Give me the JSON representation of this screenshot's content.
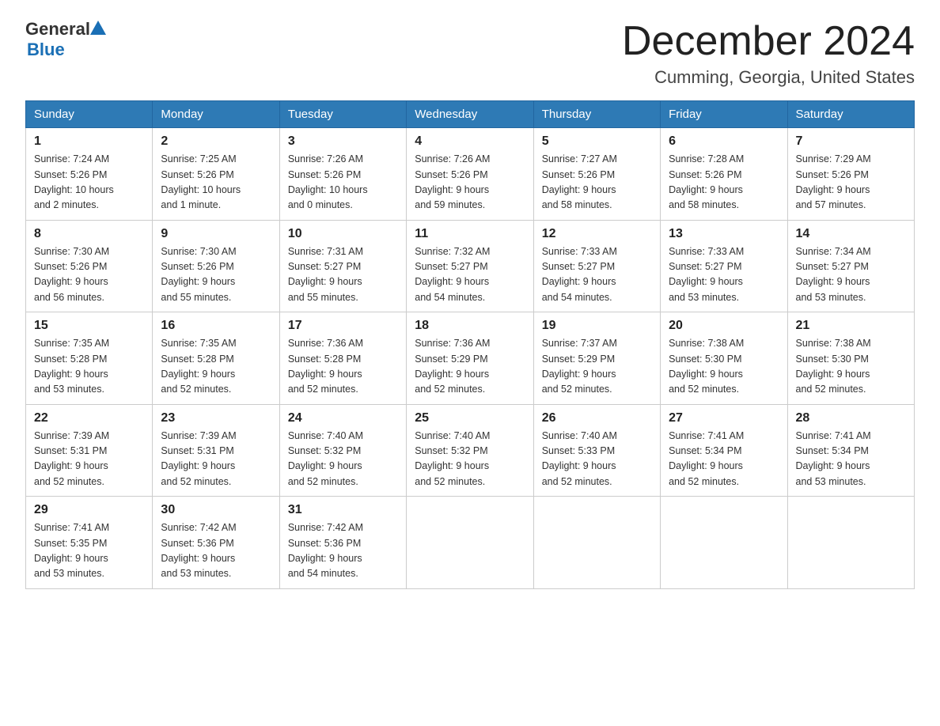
{
  "header": {
    "logo_general": "General",
    "logo_blue": "Blue",
    "title": "December 2024",
    "subtitle": "Cumming, Georgia, United States"
  },
  "days_of_week": [
    "Sunday",
    "Monday",
    "Tuesday",
    "Wednesday",
    "Thursday",
    "Friday",
    "Saturday"
  ],
  "weeks": [
    [
      {
        "day": "1",
        "sunrise": "7:24 AM",
        "sunset": "5:26 PM",
        "daylight": "10 hours and 2 minutes."
      },
      {
        "day": "2",
        "sunrise": "7:25 AM",
        "sunset": "5:26 PM",
        "daylight": "10 hours and 1 minute."
      },
      {
        "day": "3",
        "sunrise": "7:26 AM",
        "sunset": "5:26 PM",
        "daylight": "10 hours and 0 minutes."
      },
      {
        "day": "4",
        "sunrise": "7:26 AM",
        "sunset": "5:26 PM",
        "daylight": "9 hours and 59 minutes."
      },
      {
        "day": "5",
        "sunrise": "7:27 AM",
        "sunset": "5:26 PM",
        "daylight": "9 hours and 58 minutes."
      },
      {
        "day": "6",
        "sunrise": "7:28 AM",
        "sunset": "5:26 PM",
        "daylight": "9 hours and 58 minutes."
      },
      {
        "day": "7",
        "sunrise": "7:29 AM",
        "sunset": "5:26 PM",
        "daylight": "9 hours and 57 minutes."
      }
    ],
    [
      {
        "day": "8",
        "sunrise": "7:30 AM",
        "sunset": "5:26 PM",
        "daylight": "9 hours and 56 minutes."
      },
      {
        "day": "9",
        "sunrise": "7:30 AM",
        "sunset": "5:26 PM",
        "daylight": "9 hours and 55 minutes."
      },
      {
        "day": "10",
        "sunrise": "7:31 AM",
        "sunset": "5:27 PM",
        "daylight": "9 hours and 55 minutes."
      },
      {
        "day": "11",
        "sunrise": "7:32 AM",
        "sunset": "5:27 PM",
        "daylight": "9 hours and 54 minutes."
      },
      {
        "day": "12",
        "sunrise": "7:33 AM",
        "sunset": "5:27 PM",
        "daylight": "9 hours and 54 minutes."
      },
      {
        "day": "13",
        "sunrise": "7:33 AM",
        "sunset": "5:27 PM",
        "daylight": "9 hours and 53 minutes."
      },
      {
        "day": "14",
        "sunrise": "7:34 AM",
        "sunset": "5:27 PM",
        "daylight": "9 hours and 53 minutes."
      }
    ],
    [
      {
        "day": "15",
        "sunrise": "7:35 AM",
        "sunset": "5:28 PM",
        "daylight": "9 hours and 53 minutes."
      },
      {
        "day": "16",
        "sunrise": "7:35 AM",
        "sunset": "5:28 PM",
        "daylight": "9 hours and 52 minutes."
      },
      {
        "day": "17",
        "sunrise": "7:36 AM",
        "sunset": "5:28 PM",
        "daylight": "9 hours and 52 minutes."
      },
      {
        "day": "18",
        "sunrise": "7:36 AM",
        "sunset": "5:29 PM",
        "daylight": "9 hours and 52 minutes."
      },
      {
        "day": "19",
        "sunrise": "7:37 AM",
        "sunset": "5:29 PM",
        "daylight": "9 hours and 52 minutes."
      },
      {
        "day": "20",
        "sunrise": "7:38 AM",
        "sunset": "5:30 PM",
        "daylight": "9 hours and 52 minutes."
      },
      {
        "day": "21",
        "sunrise": "7:38 AM",
        "sunset": "5:30 PM",
        "daylight": "9 hours and 52 minutes."
      }
    ],
    [
      {
        "day": "22",
        "sunrise": "7:39 AM",
        "sunset": "5:31 PM",
        "daylight": "9 hours and 52 minutes."
      },
      {
        "day": "23",
        "sunrise": "7:39 AM",
        "sunset": "5:31 PM",
        "daylight": "9 hours and 52 minutes."
      },
      {
        "day": "24",
        "sunrise": "7:40 AM",
        "sunset": "5:32 PM",
        "daylight": "9 hours and 52 minutes."
      },
      {
        "day": "25",
        "sunrise": "7:40 AM",
        "sunset": "5:32 PM",
        "daylight": "9 hours and 52 minutes."
      },
      {
        "day": "26",
        "sunrise": "7:40 AM",
        "sunset": "5:33 PM",
        "daylight": "9 hours and 52 minutes."
      },
      {
        "day": "27",
        "sunrise": "7:41 AM",
        "sunset": "5:34 PM",
        "daylight": "9 hours and 52 minutes."
      },
      {
        "day": "28",
        "sunrise": "7:41 AM",
        "sunset": "5:34 PM",
        "daylight": "9 hours and 53 minutes."
      }
    ],
    [
      {
        "day": "29",
        "sunrise": "7:41 AM",
        "sunset": "5:35 PM",
        "daylight": "9 hours and 53 minutes."
      },
      {
        "day": "30",
        "sunrise": "7:42 AM",
        "sunset": "5:36 PM",
        "daylight": "9 hours and 53 minutes."
      },
      {
        "day": "31",
        "sunrise": "7:42 AM",
        "sunset": "5:36 PM",
        "daylight": "9 hours and 54 minutes."
      },
      null,
      null,
      null,
      null
    ]
  ],
  "labels": {
    "sunrise": "Sunrise:",
    "sunset": "Sunset:",
    "daylight": "Daylight:"
  }
}
